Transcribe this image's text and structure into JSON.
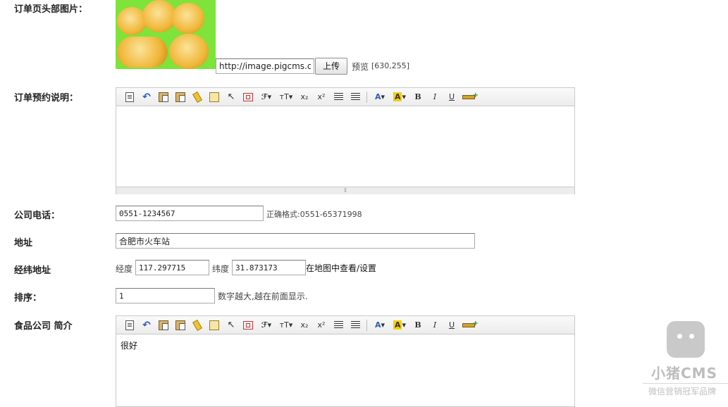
{
  "header_image": {
    "label": "订单页头部图片：",
    "url_value": "http://image.pigcms.cc",
    "upload_label": "上传",
    "preview_label": "预览",
    "size_hint": "[630,255]"
  },
  "order_desc": {
    "label": "订单预约说明：",
    "content": ""
  },
  "toolbar": {
    "subscript": "x₂",
    "superscript": "x²",
    "font_size_icon": "тT",
    "font_icon": "ℱ",
    "font_color_icon": "A",
    "highlight_icon": "A",
    "bold": "B",
    "italic": "I",
    "underline": "U"
  },
  "phone": {
    "label": "公司电话：",
    "value": "0551-1234567",
    "hint": "正确格式:0551-65371998"
  },
  "address": {
    "label": "地址",
    "value": "合肥市火车站"
  },
  "coords": {
    "label": "经纬地址",
    "lng_label": "经度",
    "lng_value": "117.297715",
    "lat_label": "纬度",
    "lat_value": "31.873173",
    "map_link": "在地图中查看/设置"
  },
  "sort": {
    "label": "排序：",
    "value": "1",
    "hint": "数字越大,越在前面显示."
  },
  "intro": {
    "label": "食品公司 简介",
    "content": "很好"
  },
  "watermark": {
    "name": "小猪CMS",
    "tagline": "微信营销冠军品牌"
  },
  "colors": {
    "image_bg": "#7ee33a",
    "highlight": "#f6d000",
    "font_color": "#2d5eb8"
  }
}
